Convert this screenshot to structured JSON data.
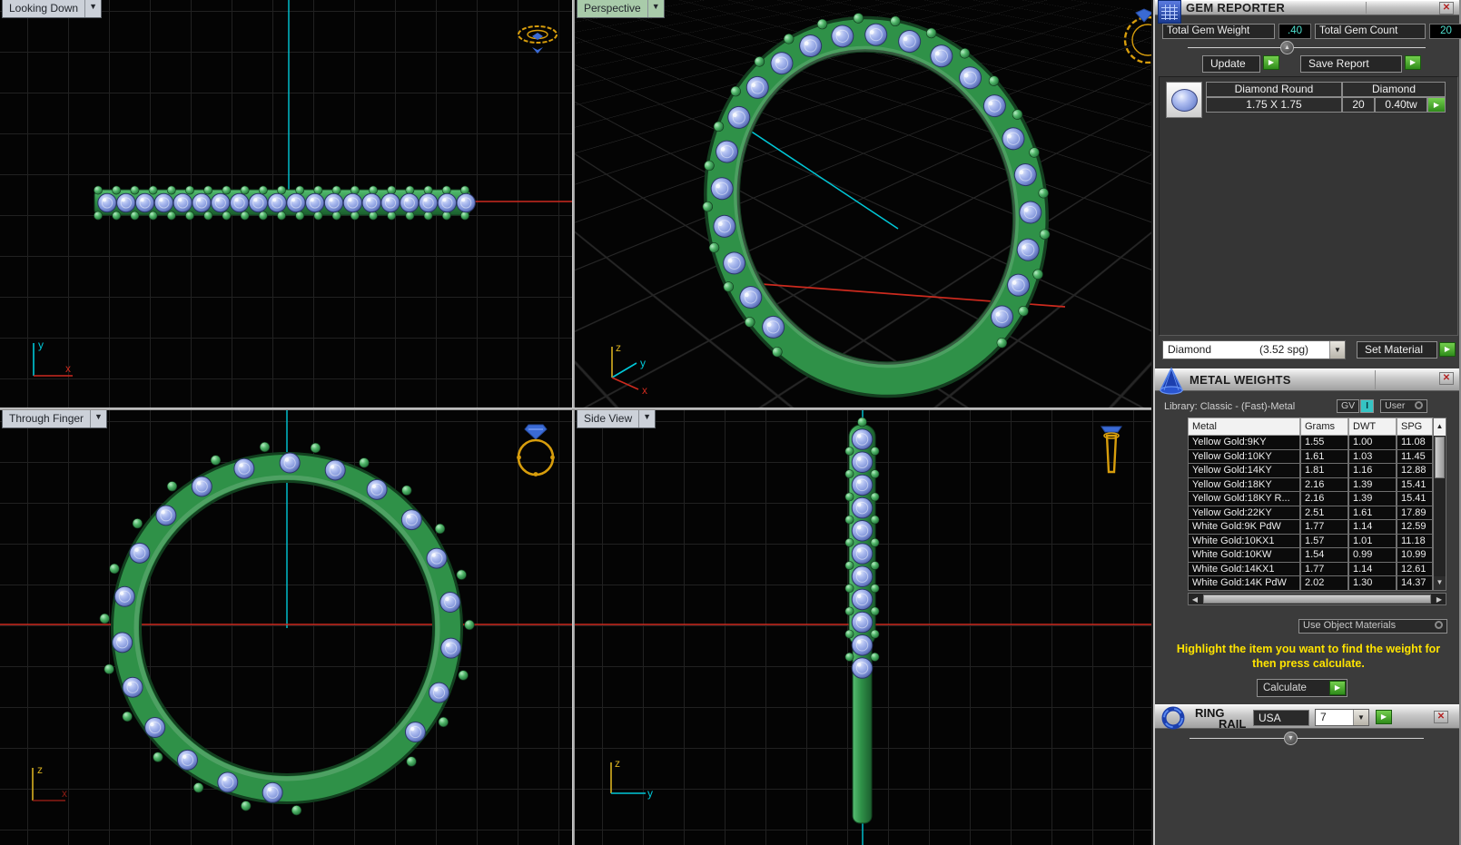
{
  "viewports": {
    "looking_down": "Looking Down",
    "perspective": "Perspective",
    "through_finger": "Through Finger",
    "side_view": "Side View"
  },
  "axes": {
    "x": "x",
    "y": "y",
    "z": "z"
  },
  "gem_reporter": {
    "title": "GEM REPORTER",
    "total_gem_weight_label": "Total Gem Weight",
    "total_gem_weight_value": ".40",
    "total_gem_count_label": "Total Gem Count",
    "total_gem_count_value": "20",
    "update_label": "Update",
    "save_report_label": "Save Report",
    "gem": {
      "shape": "Diamond Round",
      "material": "Diamond",
      "size": "1.75 X 1.75",
      "count": "20",
      "total_weight": "0.40tw"
    },
    "material_selected_name": "Diamond",
    "material_selected_spg": "(3.52 spg)",
    "set_material_label": "Set Material"
  },
  "metal_weights": {
    "title": "METAL WEIGHTS",
    "library_label": "Library: Classic - (Fast)-Metal",
    "gv_label": "GV",
    "gv_indicator": "I",
    "user_label": "User",
    "columns": [
      "Metal",
      "Grams",
      "DWT",
      "SPG"
    ],
    "rows": [
      {
        "metal": "Yellow Gold:9KY",
        "grams": "1.55",
        "dwt": "1.00",
        "spg": "11.08"
      },
      {
        "metal": "Yellow Gold:10KY",
        "grams": "1.61",
        "dwt": "1.03",
        "spg": "11.45"
      },
      {
        "metal": "Yellow Gold:14KY",
        "grams": "1.81",
        "dwt": "1.16",
        "spg": "12.88"
      },
      {
        "metal": "Yellow Gold:18KY",
        "grams": "2.16",
        "dwt": "1.39",
        "spg": "15.41"
      },
      {
        "metal": "Yellow Gold:18KY R...",
        "grams": "2.16",
        "dwt": "1.39",
        "spg": "15.41"
      },
      {
        "metal": "Yellow Gold:22KY",
        "grams": "2.51",
        "dwt": "1.61",
        "spg": "17.89"
      },
      {
        "metal": "White Gold:9K PdW",
        "grams": "1.77",
        "dwt": "1.14",
        "spg": "12.59"
      },
      {
        "metal": "White Gold:10KX1",
        "grams": "1.57",
        "dwt": "1.01",
        "spg": "11.18"
      },
      {
        "metal": "White Gold:10KW",
        "grams": "1.54",
        "dwt": "0.99",
        "spg": "10.99"
      },
      {
        "metal": "White Gold:14KX1",
        "grams": "1.77",
        "dwt": "1.14",
        "spg": "12.61"
      },
      {
        "metal": "White Gold:14K PdW",
        "grams": "2.02",
        "dwt": "1.30",
        "spg": "14.37"
      }
    ],
    "use_object_materials_label": "Use Object Materials",
    "instruction": "Highlight the item you want to find the weight for then press calculate.",
    "calculate_label": "Calculate"
  },
  "ring_rail": {
    "title_word1": "RING",
    "title_word2": "RAIL",
    "standard": "USA",
    "size": "7"
  },
  "colors": {
    "band_green": "#2f9148",
    "gem_blue": "#8598dc",
    "value_cyan": "#4fe0cf",
    "instruction_yellow": "#ffe400",
    "axis_red": "#cc2a1e",
    "axis_cyan": "#00c8d8",
    "axis_yellow": "#d8b020",
    "gold_icon": "#d79d0c"
  }
}
